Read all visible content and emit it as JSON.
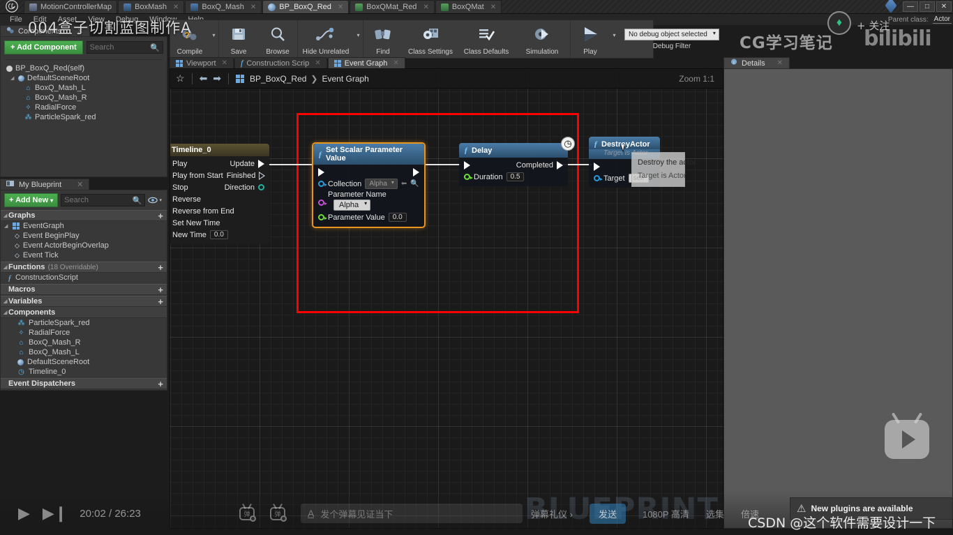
{
  "titlebar": {
    "app_icon": "unreal-logo",
    "tabs": [
      {
        "label": "MotionControllerMap",
        "icon": "level-icon",
        "active": false,
        "closable": false
      },
      {
        "label": "BoxMash",
        "icon": "blueprint-icon",
        "active": false,
        "closable": true
      },
      {
        "label": "BoxQ_Mash",
        "icon": "blueprint-icon",
        "active": false,
        "closable": true
      },
      {
        "label": "BP_BoxQ_Red",
        "icon": "blueprint-icon",
        "active": true,
        "closable": true
      },
      {
        "label": "BoxQMat_Red",
        "icon": "material-icon",
        "active": false,
        "closable": true
      },
      {
        "label": "BoxQMat",
        "icon": "material-icon",
        "active": false,
        "closable": true
      }
    ],
    "window_controls": {
      "minimize": "—",
      "maximize": "□",
      "close": "✕"
    }
  },
  "menubar": {
    "items": [
      "File",
      "Edit",
      "Asset",
      "View",
      "Debug",
      "Window",
      "Help"
    ]
  },
  "toolbar": {
    "buttons": [
      {
        "label": "Compile",
        "icon": "compile-gear-icon",
        "has_caret": true
      },
      {
        "label": "Save",
        "icon": "floppy-disk-icon",
        "has_caret": false
      },
      {
        "label": "Browse",
        "icon": "magnifier-icon",
        "has_caret": false
      },
      {
        "label": "Hide Unrelated",
        "icon": "nodes-icon",
        "has_caret": true
      },
      {
        "label": "Find",
        "icon": "binoculars-icon",
        "has_caret": false
      },
      {
        "label": "Class Settings",
        "icon": "gear-window-icon",
        "has_caret": false
      },
      {
        "label": "Class Defaults",
        "icon": "checklist-icon",
        "has_caret": false
      },
      {
        "label": "Simulation",
        "icon": "simulation-icon",
        "has_caret": false
      },
      {
        "label": "Play",
        "icon": "play-triangle-icon",
        "has_caret": true
      }
    ],
    "debug_filter_value": "No debug object selected",
    "debug_filter_caption": "Debug Filter"
  },
  "doc_tabs": [
    {
      "label": "Viewport",
      "icon": "grid-icon",
      "active": false
    },
    {
      "label": "Construction Scrip",
      "icon": "function-icon",
      "active": false
    },
    {
      "label": "Event Graph",
      "icon": "grid-icon",
      "active": true
    }
  ],
  "components_panel": {
    "tab_label": "Components",
    "add_button": "+ Add Component",
    "search_placeholder": "Search",
    "tree": [
      {
        "label": "BP_BoxQ_Red(self)",
        "indent": 0,
        "icon": "actor-sphere-icon",
        "expander": false
      },
      {
        "label": "DefaultSceneRoot",
        "indent": 1,
        "icon": "scene-root-icon",
        "expander": true
      },
      {
        "label": "BoxQ_Mash_L",
        "indent": 2,
        "icon": "static-mesh-icon",
        "expander": false
      },
      {
        "label": "BoxQ_Mash_R",
        "indent": 2,
        "icon": "static-mesh-icon",
        "expander": false
      },
      {
        "label": "RadialForce",
        "indent": 2,
        "icon": "radial-force-icon",
        "expander": false
      },
      {
        "label": "ParticleSpark_red",
        "indent": 2,
        "icon": "particle-icon",
        "expander": false
      }
    ]
  },
  "myblueprint_panel": {
    "tab_label": "My Blueprint",
    "add_button": "+ Add New",
    "search_placeholder": "Search",
    "eye_icon": "visibility-eye-icon",
    "sections": [
      {
        "title": "Graphs",
        "sub": "",
        "plus": "+",
        "items": [
          {
            "label": "EventGraph",
            "indent": 0,
            "icon": "event-graph-icon",
            "expander": true
          },
          {
            "label": "Event BeginPlay",
            "indent": 1,
            "icon": "event-node-icon",
            "expander": false
          },
          {
            "label": "Event ActorBeginOverlap",
            "indent": 1,
            "icon": "event-node-icon",
            "expander": false
          },
          {
            "label": "Event Tick",
            "indent": 1,
            "icon": "event-node-icon",
            "expander": false
          }
        ]
      },
      {
        "title": "Functions",
        "sub": "(18 Overridable)",
        "plus": "+",
        "items": [
          {
            "label": "ConstructionScript",
            "indent": 0,
            "icon": "function-icon",
            "expander": false
          }
        ]
      },
      {
        "title": "Macros",
        "sub": "",
        "plus": "+",
        "items": []
      },
      {
        "title": "Variables",
        "sub": "",
        "plus": "+",
        "items": []
      },
      {
        "title": "Components",
        "sub": "",
        "plus": "",
        "items": [
          {
            "label": "ParticleSpark_red",
            "indent": 1,
            "icon": "particle-icon",
            "expander": false
          },
          {
            "label": "RadialForce",
            "indent": 1,
            "icon": "radial-force-icon",
            "expander": false
          },
          {
            "label": "BoxQ_Mash_R",
            "indent": 1,
            "icon": "static-mesh-icon",
            "expander": false
          },
          {
            "label": "BoxQ_Mash_L",
            "indent": 1,
            "icon": "static-mesh-icon",
            "expander": false
          },
          {
            "label": "DefaultSceneRoot",
            "indent": 1,
            "icon": "scene-root-icon",
            "expander": false
          },
          {
            "label": "Timeline_0",
            "indent": 1,
            "icon": "timeline-clock-icon",
            "expander": false
          }
        ]
      },
      {
        "title": "Event Dispatchers",
        "sub": "",
        "plus": "+",
        "items": []
      }
    ]
  },
  "graph": {
    "star_icon": "favorite-star-icon",
    "back_icon": "back-arrow-icon",
    "forward_icon": "forward-arrow-icon",
    "breadcrumb_icon": "event-graph-icon",
    "breadcrumb_root": "BP_BoxQ_Red",
    "breadcrumb_sep": "❯",
    "breadcrumb_leaf": "Event Graph",
    "zoom_label": "Zoom 1:1",
    "nodes": [
      {
        "id": "timeline",
        "title": "Timeline_0",
        "inputs": [
          "Play",
          "Play from Start",
          "Stop",
          "Reverse",
          "Reverse from End",
          "Set New Time"
        ],
        "new_time_label": "New Time",
        "new_time_value": "0.0",
        "outputs": [
          "Update",
          "Finished",
          "Direction"
        ]
      },
      {
        "id": "set-scalar-parameter-value",
        "title": "Set Scalar Parameter Value",
        "selected": true,
        "collection_label": "Collection",
        "collection_value": "Alpha",
        "parameter_name_label": "Parameter Name",
        "parameter_name_value": "Alpha",
        "parameter_value_label": "Parameter Value",
        "parameter_value": "0.0"
      },
      {
        "id": "delay",
        "title": "Delay",
        "completed_label": "Completed",
        "duration_label": "Duration",
        "duration_value": "0.5",
        "badge_icon": "clock-icon"
      },
      {
        "id": "destroy-actor",
        "title": "DestroyActor",
        "subtitle": "Target is Actor",
        "target_label": "Target",
        "target_value": "self"
      }
    ],
    "tooltip": {
      "line1": "Destroy the actor",
      "line2": "Target is Actor"
    },
    "highlight_color": "#fe0000"
  },
  "details_panel": {
    "tab_label": "Details",
    "icon": "details-info-icon",
    "close": "✕"
  },
  "parent_class": {
    "label": "Parent class:",
    "value": "Actor"
  },
  "video_overlay": {
    "title": "004盒子切割蓝图制作A",
    "watermark": "CG学习笔记",
    "brand": "bilibili",
    "follow": "+ 关注",
    "blueprint_watermark": "BLUEPRINT",
    "logo_icon": "bilibili-tv-icon"
  },
  "player": {
    "play_icon": "play-icon",
    "next_icon": "next-track-icon",
    "current_time": "20:02",
    "separator": "/",
    "total_time": "26:23",
    "danmaku_off_icon": "danmaku-off-icon",
    "danmaku_on_icon": "danmaku-settings-icon",
    "danmaku_placeholder": "发个弹幕见证当下",
    "danmaku_a_icon": "font-style-icon",
    "gift_label": "弹幕礼仪 ›",
    "send_label": "发送",
    "quality_label": "1080P 高清",
    "episodes_label": "选集",
    "speed_label": "倍速"
  },
  "notification": {
    "icon": "warning-triangle-icon",
    "text": "New plugins are available"
  },
  "csdn_watermark": "CSDN @这个软件需要设计一下"
}
